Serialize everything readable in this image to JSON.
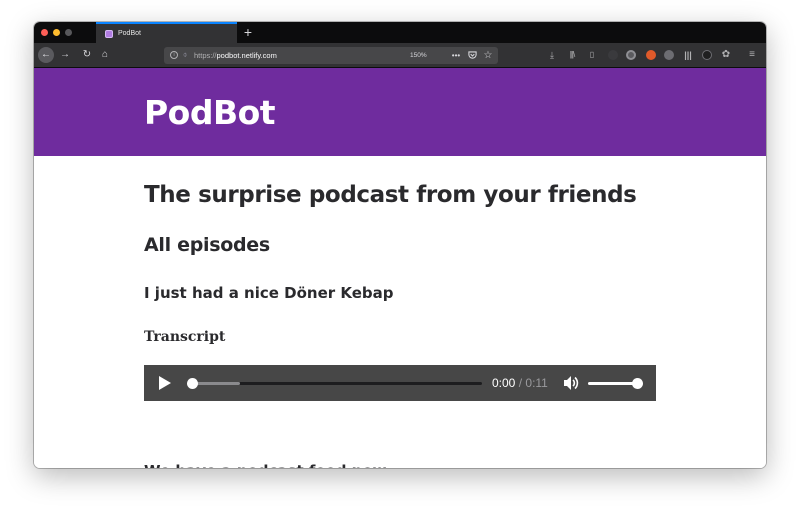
{
  "browser": {
    "tab_title": "PodBot",
    "new_tab_glyph": "+",
    "url_scheme": "https://",
    "url_host": "podbot.netlify.com",
    "zoom": "150%",
    "icons": {
      "back": "←",
      "forward": "→",
      "reload": "↻",
      "home": "⌂",
      "info": "i",
      "page_actions": "•••",
      "pocket": "◡",
      "bookmark": "☆",
      "download": "⤓",
      "library": "|||\\",
      "sidebar": "▯",
      "menu": "≡"
    }
  },
  "site": {
    "title": "PodBot",
    "brand_color": "#6f2c9e"
  },
  "content": {
    "tagline": "The surprise podcast from your friends",
    "section_heading": "All episodes",
    "episode_title": "I just had a nice Döner Kebap",
    "transcript_label": "Transcript",
    "feed_heading": "We have a podcast feed now."
  },
  "audio_player": {
    "current_time": "0:00",
    "separator": "/",
    "duration": "0:11",
    "progress": 0,
    "volume": 1
  }
}
